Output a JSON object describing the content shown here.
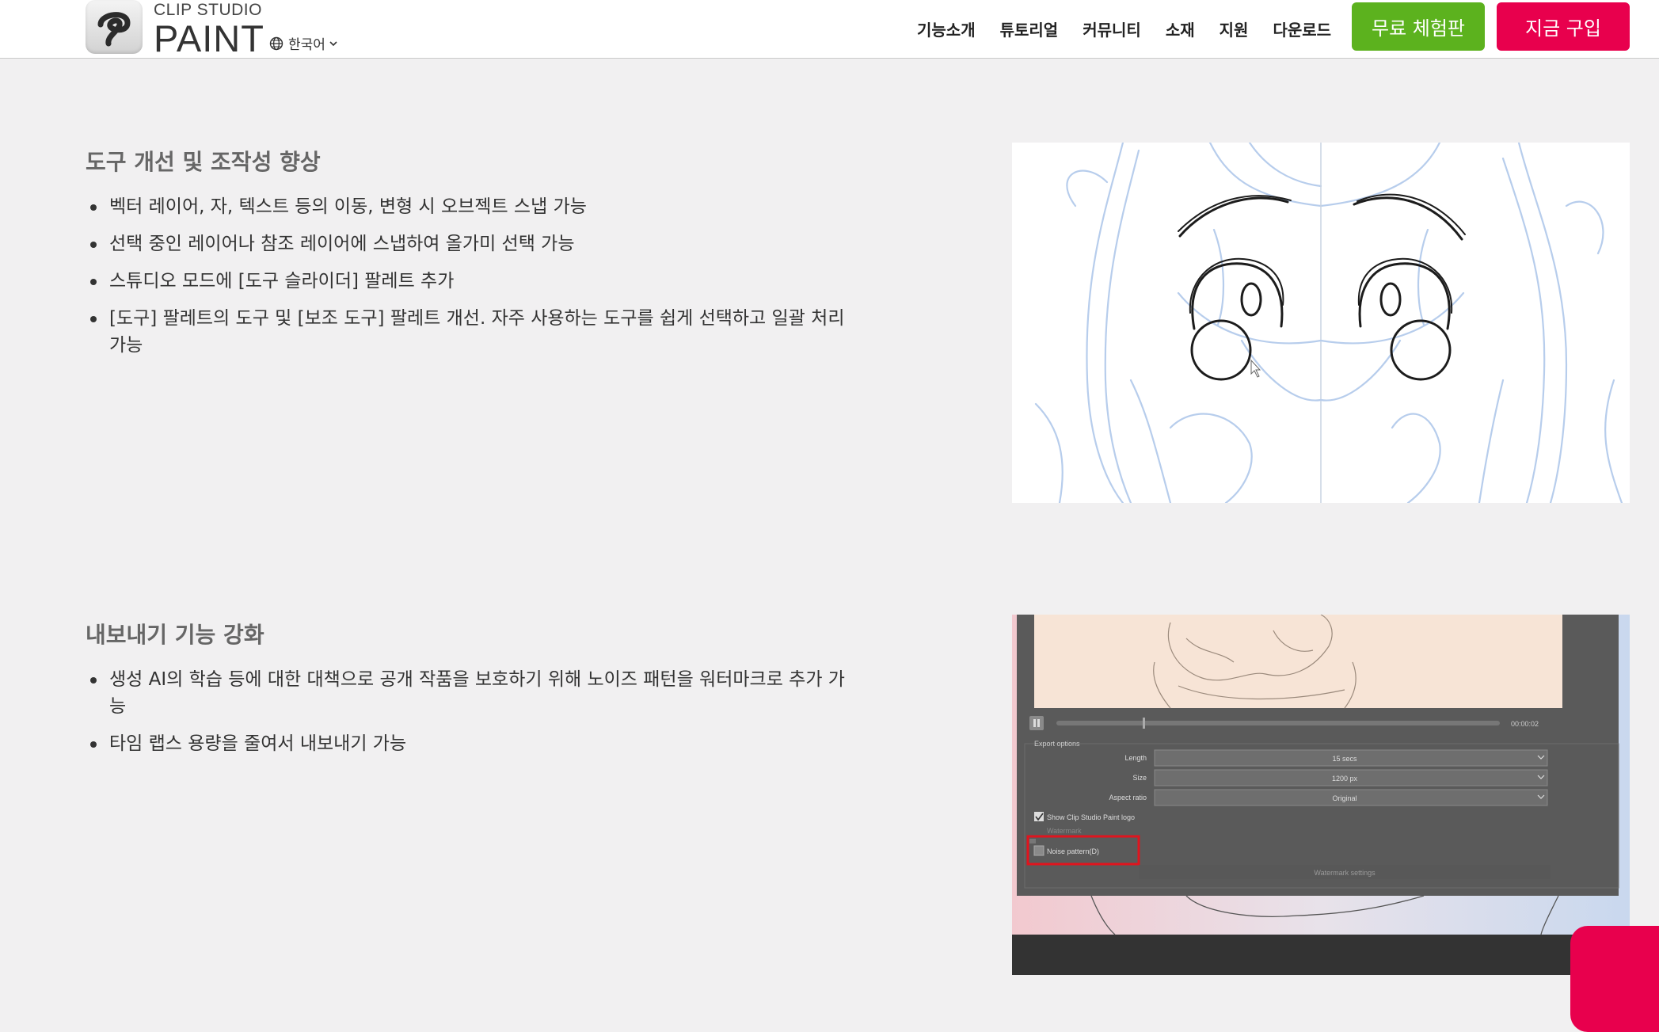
{
  "brand": {
    "line1": "CLIP STUDIO",
    "line2": "PAINT",
    "logo_icon": "clip-studio-logo-icon"
  },
  "language": {
    "label": "한국어",
    "icon": "globe-icon"
  },
  "nav": [
    {
      "label": "기능소개"
    },
    {
      "label": "튜토리얼"
    },
    {
      "label": "커뮤니티"
    },
    {
      "label": "소재"
    },
    {
      "label": "지원"
    },
    {
      "label": "다운로드"
    }
  ],
  "cta": {
    "trial_label": "무료 체험판",
    "trial_color": "#5cb21e",
    "buy_label": "지금 구입",
    "buy_color": "#e8004d"
  },
  "sections": [
    {
      "title": "도구 개선 및 조작성 향상",
      "items": [
        "벡터 레이어, 자, 텍스트 등의 이동, 변형 시 오브젝트 스냅 가능",
        "선택 중인 레이어나 참조 레이어에 스냅하여 올가미 선택 가능",
        "스튜디오 모드에 [도구 슬라이더] 팔레트 추가",
        "[도구] 팔레트의 도구 및 [보조 도구] 팔레트 개선. 자주 사용하는 도구를 쉽게 선택하고 일괄 처리 가능"
      ]
    },
    {
      "title": "내보내기 기능 강화",
      "items": [
        "생성 AI의 학습 등에 대한 대책으로 공개 작품을 보호하기 위해 노이즈 패턴을 워터마크로 추가 가능",
        "타임 랩스 용량을 줄여서 내보내기 가능"
      ]
    }
  ],
  "export_dialog": {
    "time": "00:00:02",
    "group_label": "Export options",
    "length_label": "Length",
    "length_value": "15 secs",
    "size_label": "Size",
    "size_value": "1200 px",
    "aspect_label": "Aspect ratio",
    "aspect_value": "Original",
    "show_logo_label": "Show Clip Studio Paint logo",
    "watermark_label": "Watermark",
    "noise_label": "Noise pattern(D)",
    "watermark_settings_label": "Watermark settings"
  }
}
